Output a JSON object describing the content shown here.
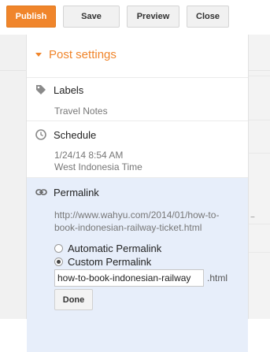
{
  "toolbar": {
    "publish_label": "Publish",
    "save_label": "Save",
    "preview_label": "Preview",
    "close_label": "Close"
  },
  "panel": {
    "title": "Post settings",
    "labels": {
      "title": "Labels",
      "value": "Travel Notes"
    },
    "schedule": {
      "title": "Schedule",
      "date": "1/24/14 8:54 AM",
      "timezone": "West Indonesia Time"
    },
    "permalink": {
      "title": "Permalink",
      "url_line1": "http://www.wahyu.com/2014/01/how-to-",
      "url_line2": "book-indonesian-railway-ticket.html",
      "option_automatic": "Automatic Permalink",
      "option_custom": "Custom Permalink",
      "selected_option": "Custom Permalink",
      "slug_value": "how-to-book-indonesian-railway",
      "suffix": ".html",
      "done_label": "Done"
    }
  },
  "colors": {
    "accent": "#f0852b",
    "permalink_bg": "#e7eefa"
  },
  "icons": {
    "labels": "tag-icon",
    "schedule": "clock-icon",
    "permalink": "link-icon",
    "section_toggle": "caret-down-icon"
  }
}
